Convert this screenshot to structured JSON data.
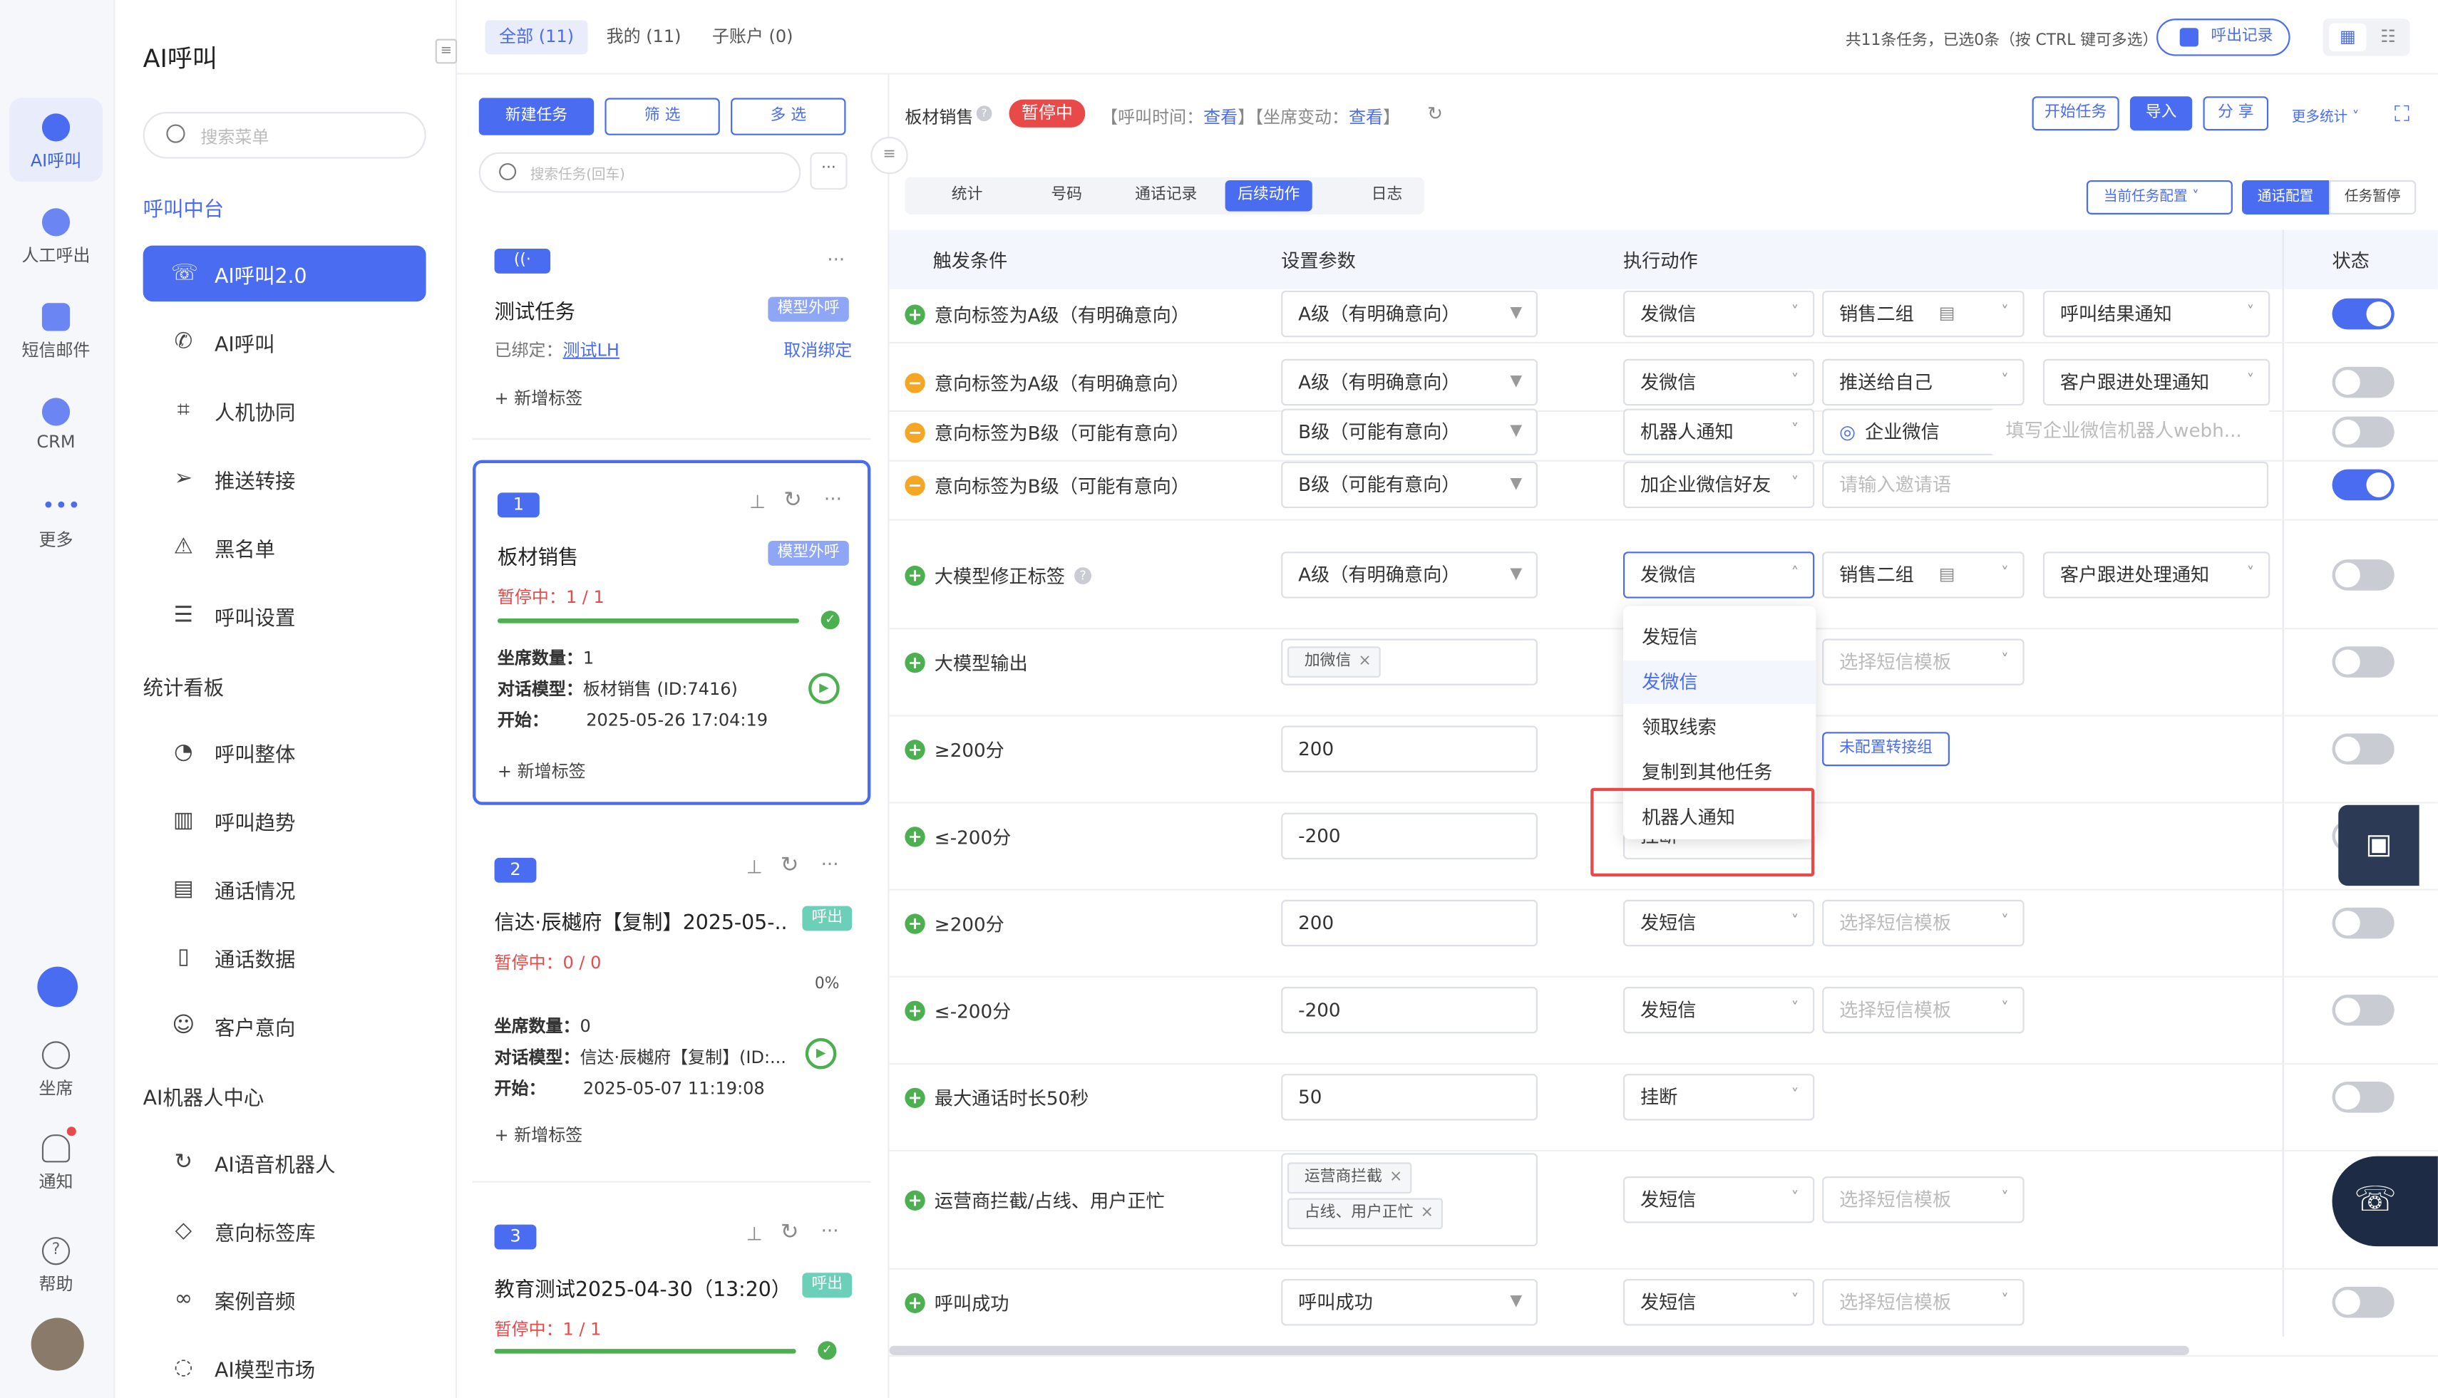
{
  "rail": {
    "items": [
      {
        "label": "AI呼叫"
      },
      {
        "label": "人工呼出"
      },
      {
        "label": "短信邮件"
      },
      {
        "label": "CRM"
      },
      {
        "label": "更多"
      }
    ],
    "bottom": [
      {
        "label": "坐席"
      },
      {
        "label": "通知"
      },
      {
        "label": "帮助"
      }
    ]
  },
  "menu": {
    "title": "AI呼叫",
    "search_placeholder": "搜索菜单",
    "group1": "呼叫中台",
    "items1": [
      "AI呼叫2.0",
      "AI呼叫",
      "人机协同",
      "推送转接",
      "黑名单",
      "呼叫设置"
    ],
    "group2": "统计看板",
    "items2": [
      "呼叫整体",
      "呼叫趋势",
      "通话情况",
      "通话数据",
      "客户意向"
    ],
    "group3": "AI机器人中心",
    "items3": [
      "AI语音机器人",
      "意向标签库",
      "案例音频",
      "AI模型市场"
    ]
  },
  "topbar": {
    "tabs": [
      "全部 (11)",
      "我的 (11)",
      "子账户 (0)"
    ],
    "summary": "共11条任务，已选0条（按 CTRL 键可多选）",
    "export": "呼出记录"
  },
  "tasks": {
    "new_btn": "新建任务",
    "filter_btn": "筛 选",
    "multi_btn": "多 选",
    "search_placeholder": "搜索任务(回车)",
    "test": {
      "name": "测试任务",
      "badge": "模型外呼",
      "bound_label": "已绑定：",
      "bound_value": "测试LH",
      "unbind": "取消绑定",
      "add_tag": "+ 新增标签"
    },
    "cards": [
      {
        "num": "1",
        "name": "板材销售",
        "badge": "模型外呼",
        "status": "暂停中：1 / 1",
        "progress": 1,
        "seats_label": "坐席数量：",
        "seats": "1",
        "model_label": "对话模型：",
        "model": "板材销售 (ID:7416)",
        "start_label": "开始：",
        "start": "2025-05-26 17:04:19",
        "add_tag": "+ 新增标签"
      },
      {
        "num": "2",
        "name": "信达·辰樾府【复制】2025-05-...",
        "badge": "呼出",
        "status": "暂停中：0 / 0",
        "progress": 0,
        "percent": "0%",
        "seats_label": "坐席数量：",
        "seats": "0",
        "model_label": "对话模型：",
        "model": "信达·辰樾府【复制】(ID:...",
        "start_label": "开始：",
        "start": "2025-05-07 11:19:08",
        "add_tag": "+ 新增标签"
      },
      {
        "num": "3",
        "name": "教育测试2025-04-30（13:20）",
        "badge": "呼出",
        "status": "暂停中：1 / 1",
        "progress": 1
      }
    ]
  },
  "header": {
    "task_name": "板材销售",
    "status": "暂停中",
    "call_time_label": "【呼叫时间：",
    "view1": "查看",
    "mid": "】【坐席变动：",
    "view2": "查看",
    "end": "】",
    "buttons": [
      "开始任务",
      "导入",
      "分 享"
    ],
    "more_stats": "更多统计"
  },
  "subtabs": [
    "统计",
    "号码",
    "通话记录",
    "后续动作",
    "日志"
  ],
  "right_tabs": [
    "当前任务配置",
    "通话配置",
    "任务暂停"
  ],
  "columns": [
    "触发条件",
    "设置参数",
    "执行动作",
    "状态"
  ],
  "rows": [
    {
      "icon": "plus",
      "trigger": "意向标签为A级（有明确意向）",
      "param": "A级（有明确意向）",
      "action": "发微信",
      "a2": "销售二组",
      "a3": "呼叫结果通知",
      "on": true
    },
    {
      "icon": "minus",
      "trigger": "意向标签为A级（有明确意向）",
      "param": "A级（有明确意向）",
      "action": "发微信",
      "a2": "推送给自己",
      "a3": "客户跟进处理通知",
      "on": false
    },
    {
      "icon": "minus",
      "trigger": "意向标签为B级（可能有意向）",
      "param": "B级（可能有意向）",
      "action": "机器人通知",
      "a2": "企业微信",
      "a3": "填写企业微信机器人webh...",
      "on": false
    },
    {
      "icon": "minus",
      "trigger": "意向标签为B级（可能有意向）",
      "param": "B级（可能有意向）",
      "action": "加企业微信好友",
      "a2": "请输入邀请语",
      "on": true
    },
    {
      "icon": "plus",
      "trigger": "大模型修正标签",
      "param": "A级（有明确意向）",
      "action": "发微信",
      "a2": "销售二组",
      "a3": "客户跟进处理通知",
      "on": false
    },
    {
      "icon": "plus",
      "trigger": "大模型输出",
      "chip": "加微信",
      "a2": "选择短信模板",
      "on": false
    },
    {
      "icon": "plus",
      "trigger": "≥200分",
      "param": "200",
      "link": "未配置转接组",
      "on": false
    },
    {
      "icon": "plus",
      "trigger": "≤-200分",
      "param": "-200",
      "action": "挂断",
      "on": false
    },
    {
      "icon": "plus",
      "trigger": "≥200分",
      "param": "200",
      "action": "发短信",
      "a2": "选择短信模板",
      "on": false
    },
    {
      "icon": "plus",
      "trigger": "≤-200分",
      "param": "-200",
      "action": "发短信",
      "a2": "选择短信模板",
      "on": false
    },
    {
      "icon": "plus",
      "trigger": "最大通话时长50秒",
      "param": "50",
      "action": "挂断",
      "on": false
    },
    {
      "icon": "plus",
      "trigger": "运营商拦截/占线、用户正忙",
      "chips": [
        "运营商拦截",
        "占线、用户正忙"
      ],
      "action": "发短信",
      "a2": "选择短信模板"
    },
    {
      "icon": "plus",
      "trigger": "呼叫成功",
      "param": "呼叫成功",
      "action": "发短信",
      "a2": "选择短信模板",
      "on": false
    }
  ],
  "dropdown": {
    "options": [
      "发短信",
      "发微信",
      "领取线索",
      "复制到其他任务",
      "机器人通知"
    ],
    "selected": "发微信"
  },
  "colors": {
    "primary": "#4a6cf0",
    "danger": "#e84a4a",
    "success": "#4caf50",
    "warn": "#f5a623"
  }
}
